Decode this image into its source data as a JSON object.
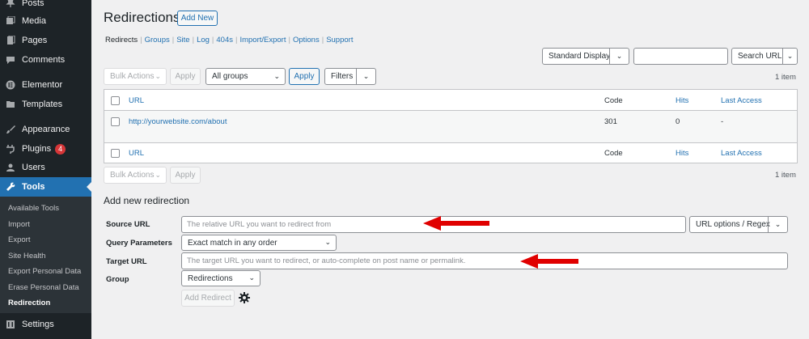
{
  "sidebar": {
    "items": [
      {
        "label": "Posts",
        "icon": "pin-icon"
      },
      {
        "label": "Media",
        "icon": "media-icon"
      },
      {
        "label": "Pages",
        "icon": "pages-icon"
      },
      {
        "label": "Comments",
        "icon": "comments-icon"
      },
      {
        "label": "Elementor",
        "icon": "elementor-icon"
      },
      {
        "label": "Templates",
        "icon": "folder-icon"
      },
      {
        "label": "Appearance",
        "icon": "brush-icon"
      },
      {
        "label": "Plugins",
        "icon": "plugin-icon",
        "badge": "4"
      },
      {
        "label": "Users",
        "icon": "users-icon"
      },
      {
        "label": "Tools",
        "icon": "wrench-icon"
      },
      {
        "label": "Settings",
        "icon": "settings-icon"
      }
    ],
    "submenu": [
      "Available Tools",
      "Import",
      "Export",
      "Site Health",
      "Export Personal Data",
      "Erase Personal Data",
      "Redirection"
    ]
  },
  "header": {
    "title": "Redirections",
    "add_new": "Add New"
  },
  "subnav": [
    "Redirects",
    "Groups",
    "Site",
    "Log",
    "404s",
    "Import/Export",
    "Options",
    "Support"
  ],
  "display": {
    "mode": "Standard Display",
    "search_value": "",
    "search_button": "Search URL"
  },
  "tablenav_top": {
    "bulk_actions": "Bulk Actions",
    "apply": "Apply",
    "group_filter": "All groups",
    "apply_group": "Apply",
    "filters": "Filters",
    "count": "1 item"
  },
  "table": {
    "columns": {
      "url": "URL",
      "code": "Code",
      "hits": "Hits",
      "last_access": "Last Access"
    },
    "rows": [
      {
        "url": "http://yourwebsite.com/about",
        "code": "301",
        "hits": "0",
        "last_access": "-"
      }
    ]
  },
  "tablenav_bottom": {
    "bulk_actions": "Bulk Actions",
    "apply": "Apply",
    "count": "1 item"
  },
  "form": {
    "title": "Add new redirection",
    "source_label": "Source URL",
    "source_placeholder": "The relative URL you want to redirect from",
    "url_options": "URL options / Regex",
    "query_label": "Query Parameters",
    "query_value": "Exact match in any order",
    "target_label": "Target URL",
    "target_placeholder": "The target URL you want to redirect, or auto-complete on post name or permalink.",
    "group_label": "Group",
    "group_value": "Redirections",
    "submit": "Add Redirect"
  },
  "colors": {
    "sidebar_bg": "#1d2327",
    "accent": "#2271b1",
    "annotation_arrow": "#e00000"
  }
}
